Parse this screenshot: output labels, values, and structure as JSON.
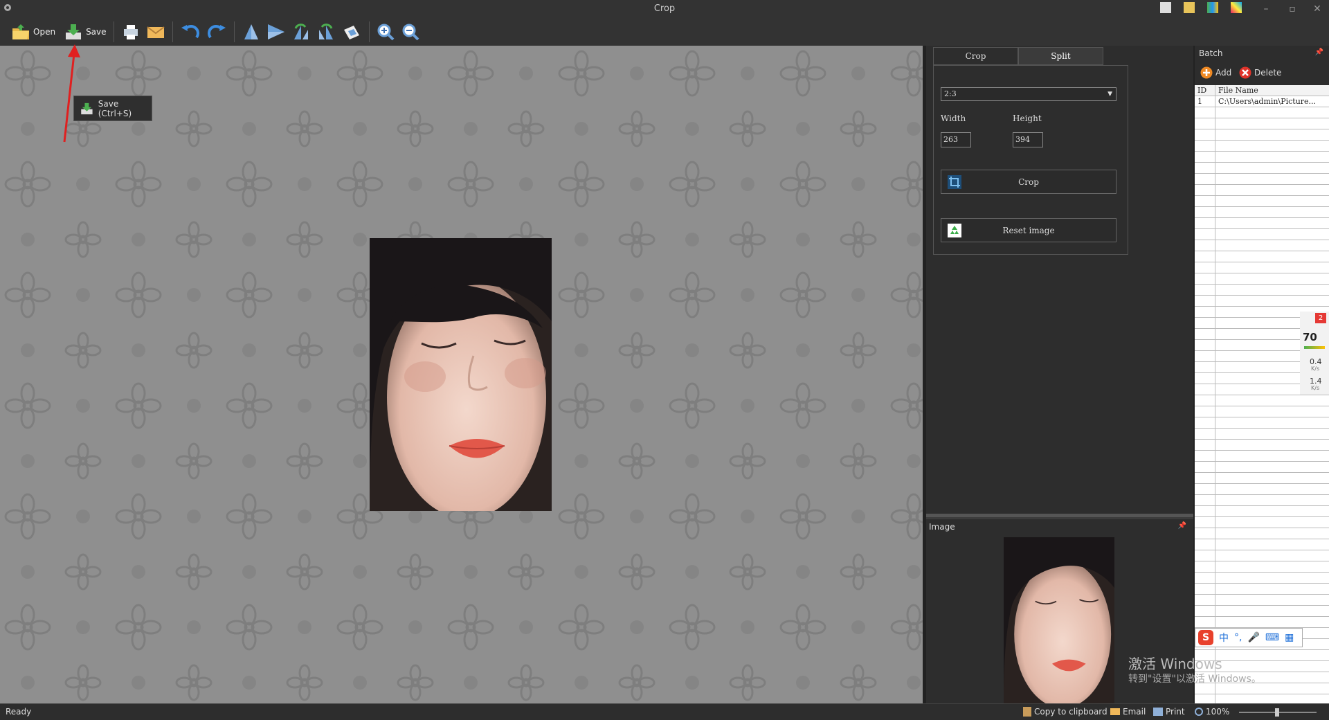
{
  "window": {
    "title": "Crop"
  },
  "toolbar": {
    "open_label": "Open",
    "save_label": "Save",
    "tooltip": "Save (Ctrl+S)"
  },
  "crop_panel": {
    "tabs": [
      "Crop",
      "Split"
    ],
    "active_tab": "Split",
    "ratio": "2:3",
    "width_label": "Width",
    "height_label": "Height",
    "width_value": "263",
    "height_value": "394",
    "crop_button": "Crop",
    "reset_button": "Reset image"
  },
  "image_panel": {
    "title": "Image"
  },
  "batch": {
    "title": "Batch",
    "add_label": "Add",
    "delete_label": "Delete",
    "columns": [
      "ID",
      "File Name"
    ],
    "rows": [
      {
        "id": "1",
        "file": "C:\\Users\\admin\\Picture..."
      }
    ]
  },
  "overlay": {
    "watermark_title": "激活 Windows",
    "watermark_sub": "转到\"设置\"以激活 Windows。",
    "ime_label": "中",
    "monitor_badge": "2",
    "monitor_percent": "70",
    "monitor_up": "0.4",
    "monitor_down": "1.4",
    "monitor_unit": "K/s"
  },
  "statusbar": {
    "status": "Ready",
    "copy_label": "Copy to clipboard",
    "email_label": "Email",
    "print_label": "Print",
    "zoom": "100%"
  },
  "colors": {
    "accent_red": "#e02020",
    "panel_bg": "#2d2d2d",
    "canvas_bg": "#8f8f8f"
  }
}
